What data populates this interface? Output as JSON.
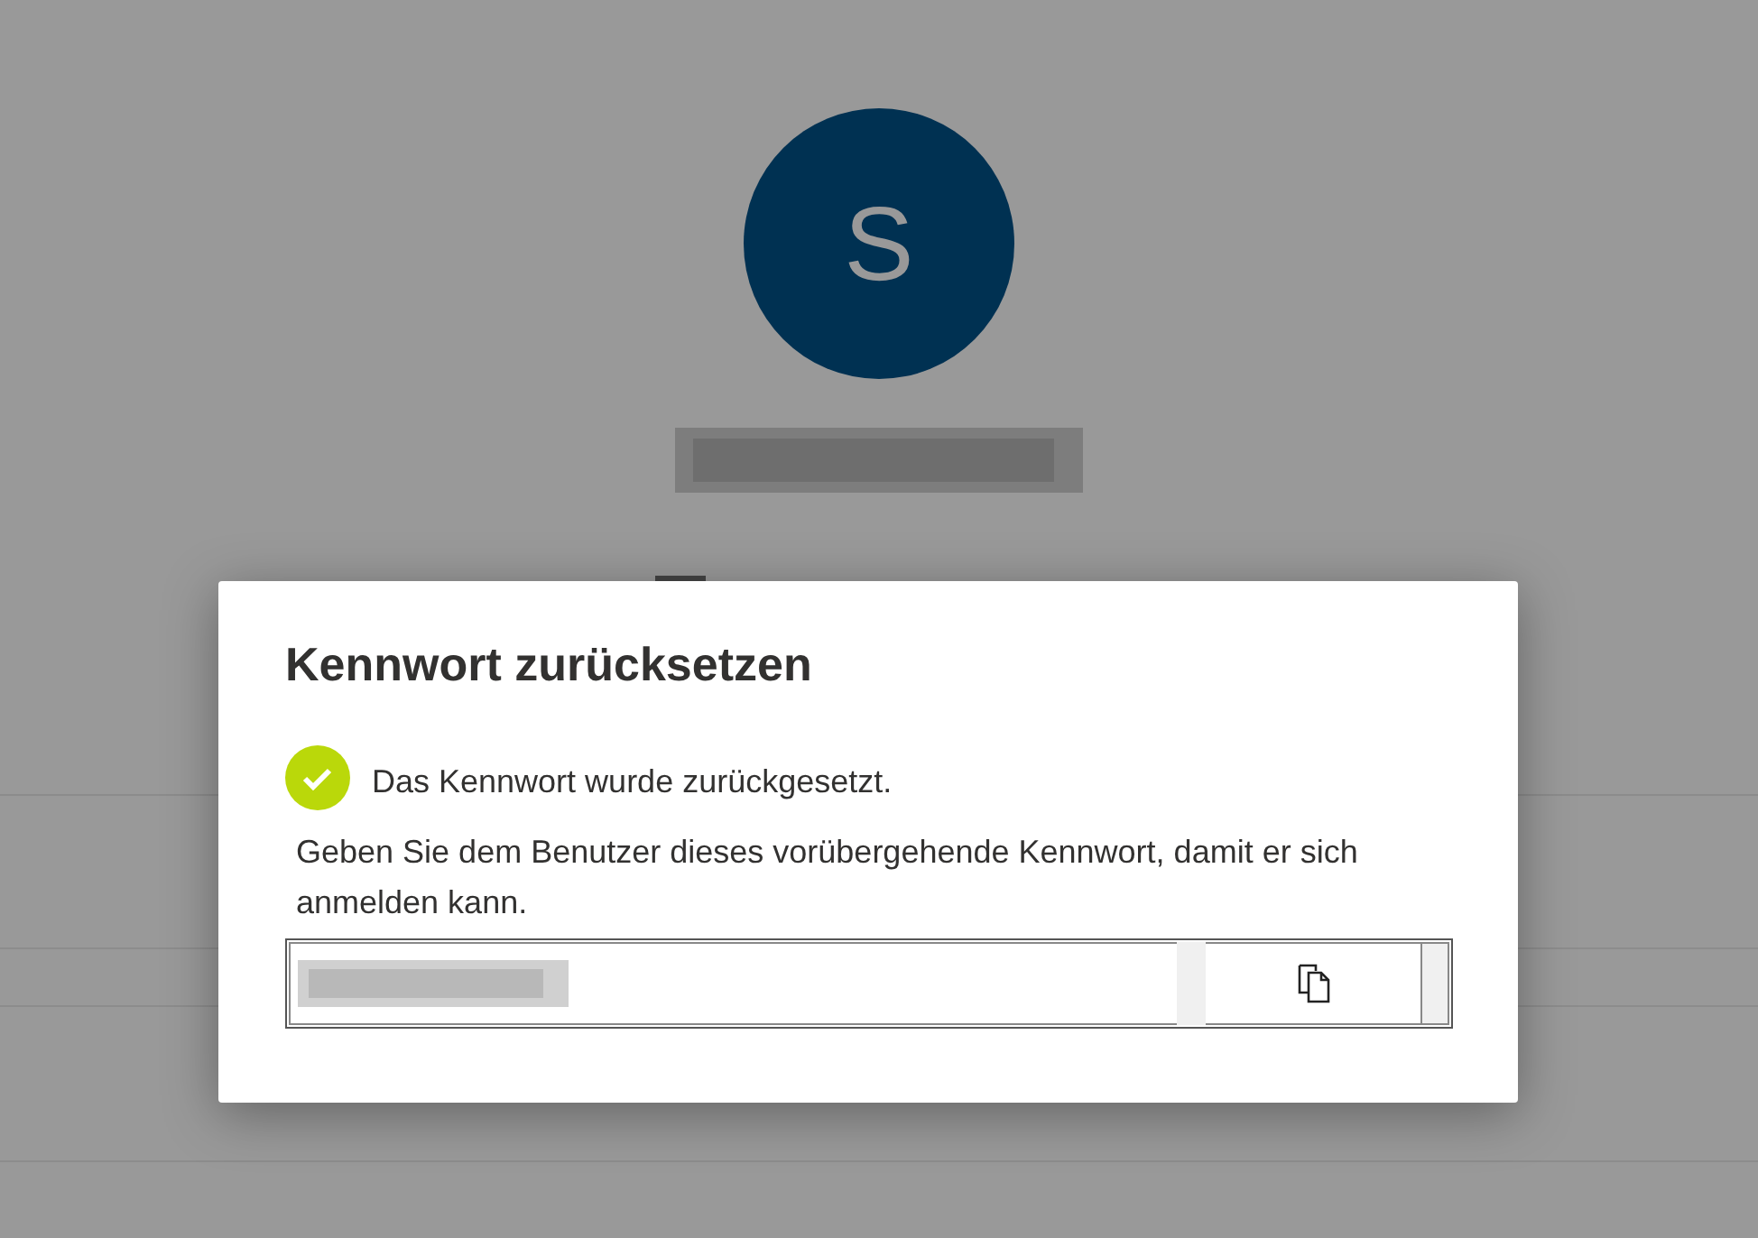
{
  "avatar": {
    "initial": "S"
  },
  "dialog": {
    "title": "Kennwort zurücksetzen",
    "status": {
      "kind": "success",
      "message": "Das Kennwort wurde zurückgesetzt."
    },
    "instruction": "Geben Sie dem Benutzer dieses vorübergehende Kennwort, damit er sich anmelden kann."
  }
}
